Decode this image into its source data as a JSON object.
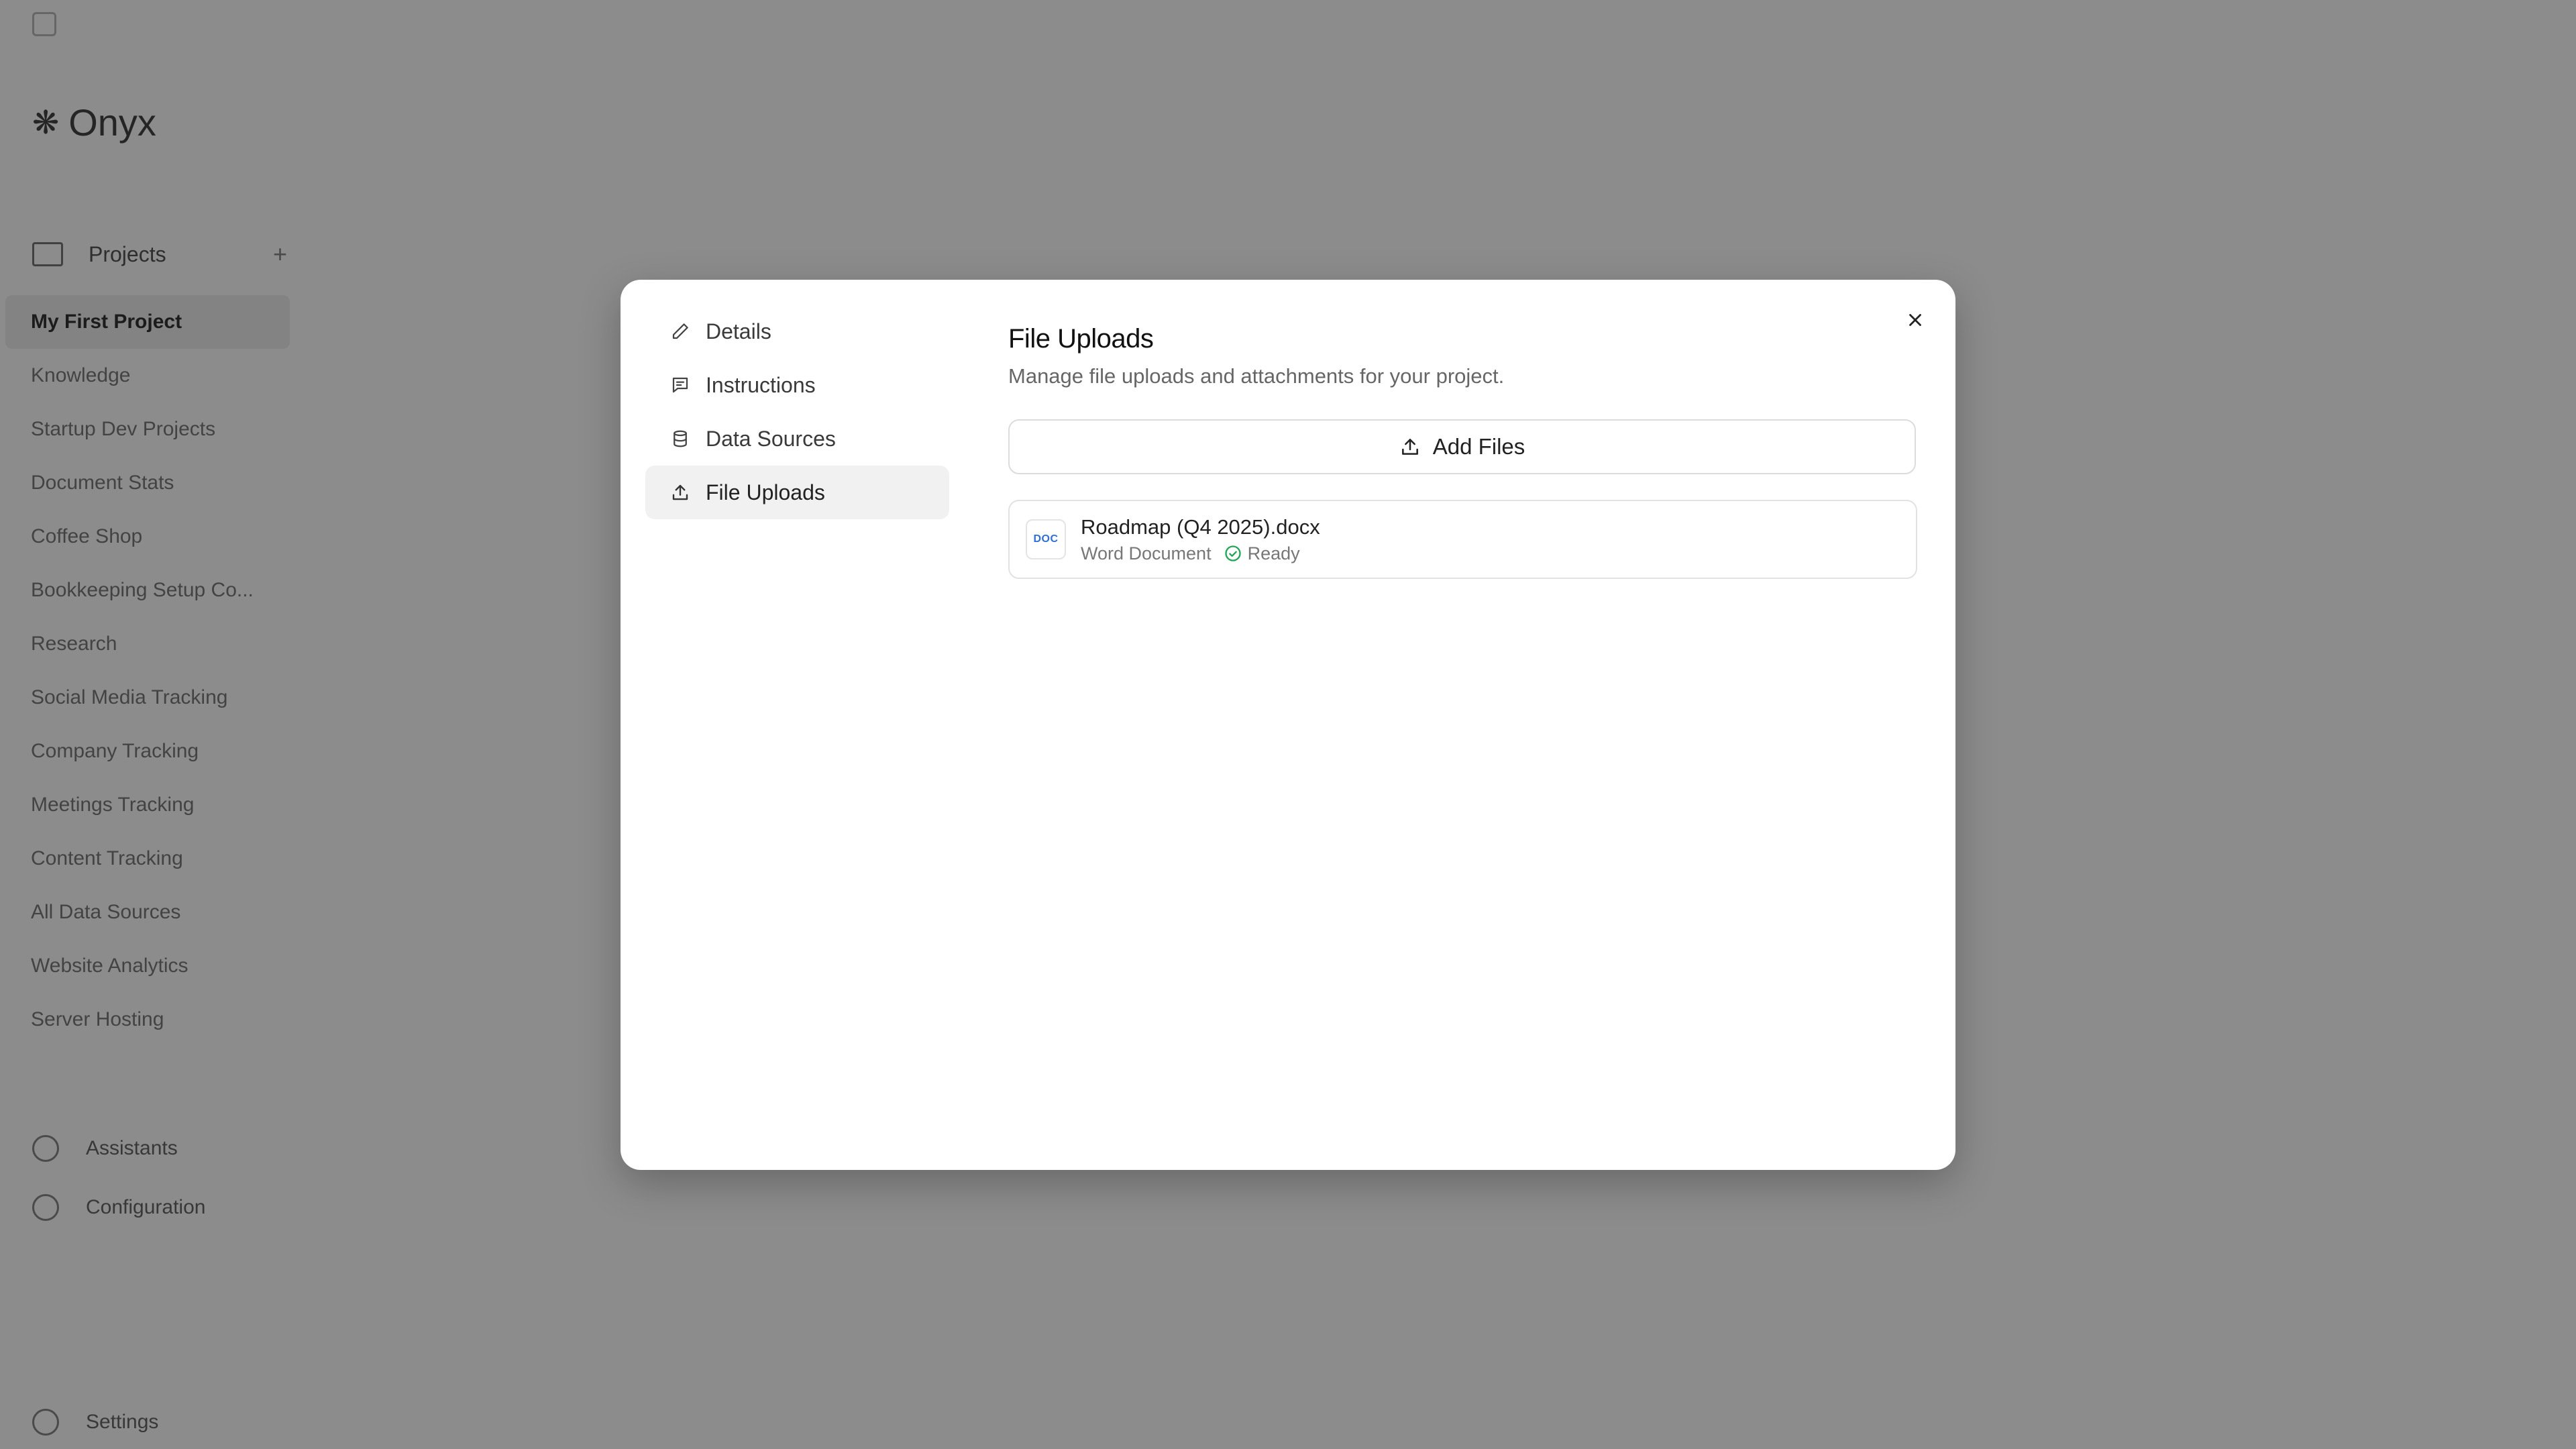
{
  "background": {
    "breadcrumbs": [
      "",
      ""
    ],
    "brand_name": "Onyx",
    "projects_heading": "Projects",
    "project_items": [
      "My First Project",
      "Knowledge",
      "Startup Dev Projects",
      "Document Stats",
      "Coffee Shop",
      "Bookkeeping Setup Co...",
      "Research",
      "Social Media Tracking",
      "Company Tracking",
      "Meetings Tracking",
      "Content Tracking",
      "All Data Sources",
      "Website Analytics",
      "Server Hosting"
    ],
    "bottom_nav": [
      "Assistants",
      "Configuration"
    ],
    "user_label": "Settings",
    "main_title": "",
    "main_description": "",
    "footer_text": ""
  },
  "modal": {
    "nav": [
      {
        "label": "Details",
        "icon": "pencil-icon"
      },
      {
        "label": "Instructions",
        "icon": "message-icon"
      },
      {
        "label": "Data Sources",
        "icon": "database-icon"
      },
      {
        "label": "File Uploads",
        "icon": "upload-icon"
      }
    ],
    "active_nav": "File Uploads",
    "title": "File Uploads",
    "subtitle": "Manage file uploads and attachments for your project.",
    "add_files_label": "Add Files",
    "files": [
      {
        "name": "Roadmap (Q4 2025).docx",
        "thumb_label": "DOC",
        "type": "Word Document",
        "status": "Ready"
      }
    ]
  },
  "colors": {
    "accent_doc": "#2f6fd6",
    "status_ready": "#22a559"
  }
}
